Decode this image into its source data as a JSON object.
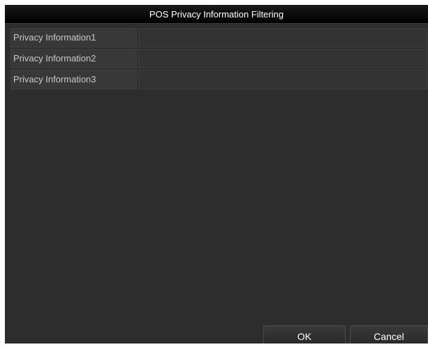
{
  "dialog": {
    "title": "POS Privacy Information Filtering"
  },
  "rows": [
    {
      "label": "Privacy Information1",
      "value": ""
    },
    {
      "label": "Privacy Information2",
      "value": ""
    },
    {
      "label": "Privacy Information3",
      "value": ""
    }
  ],
  "buttons": {
    "ok_label": "OK",
    "cancel_label": "Cancel"
  }
}
